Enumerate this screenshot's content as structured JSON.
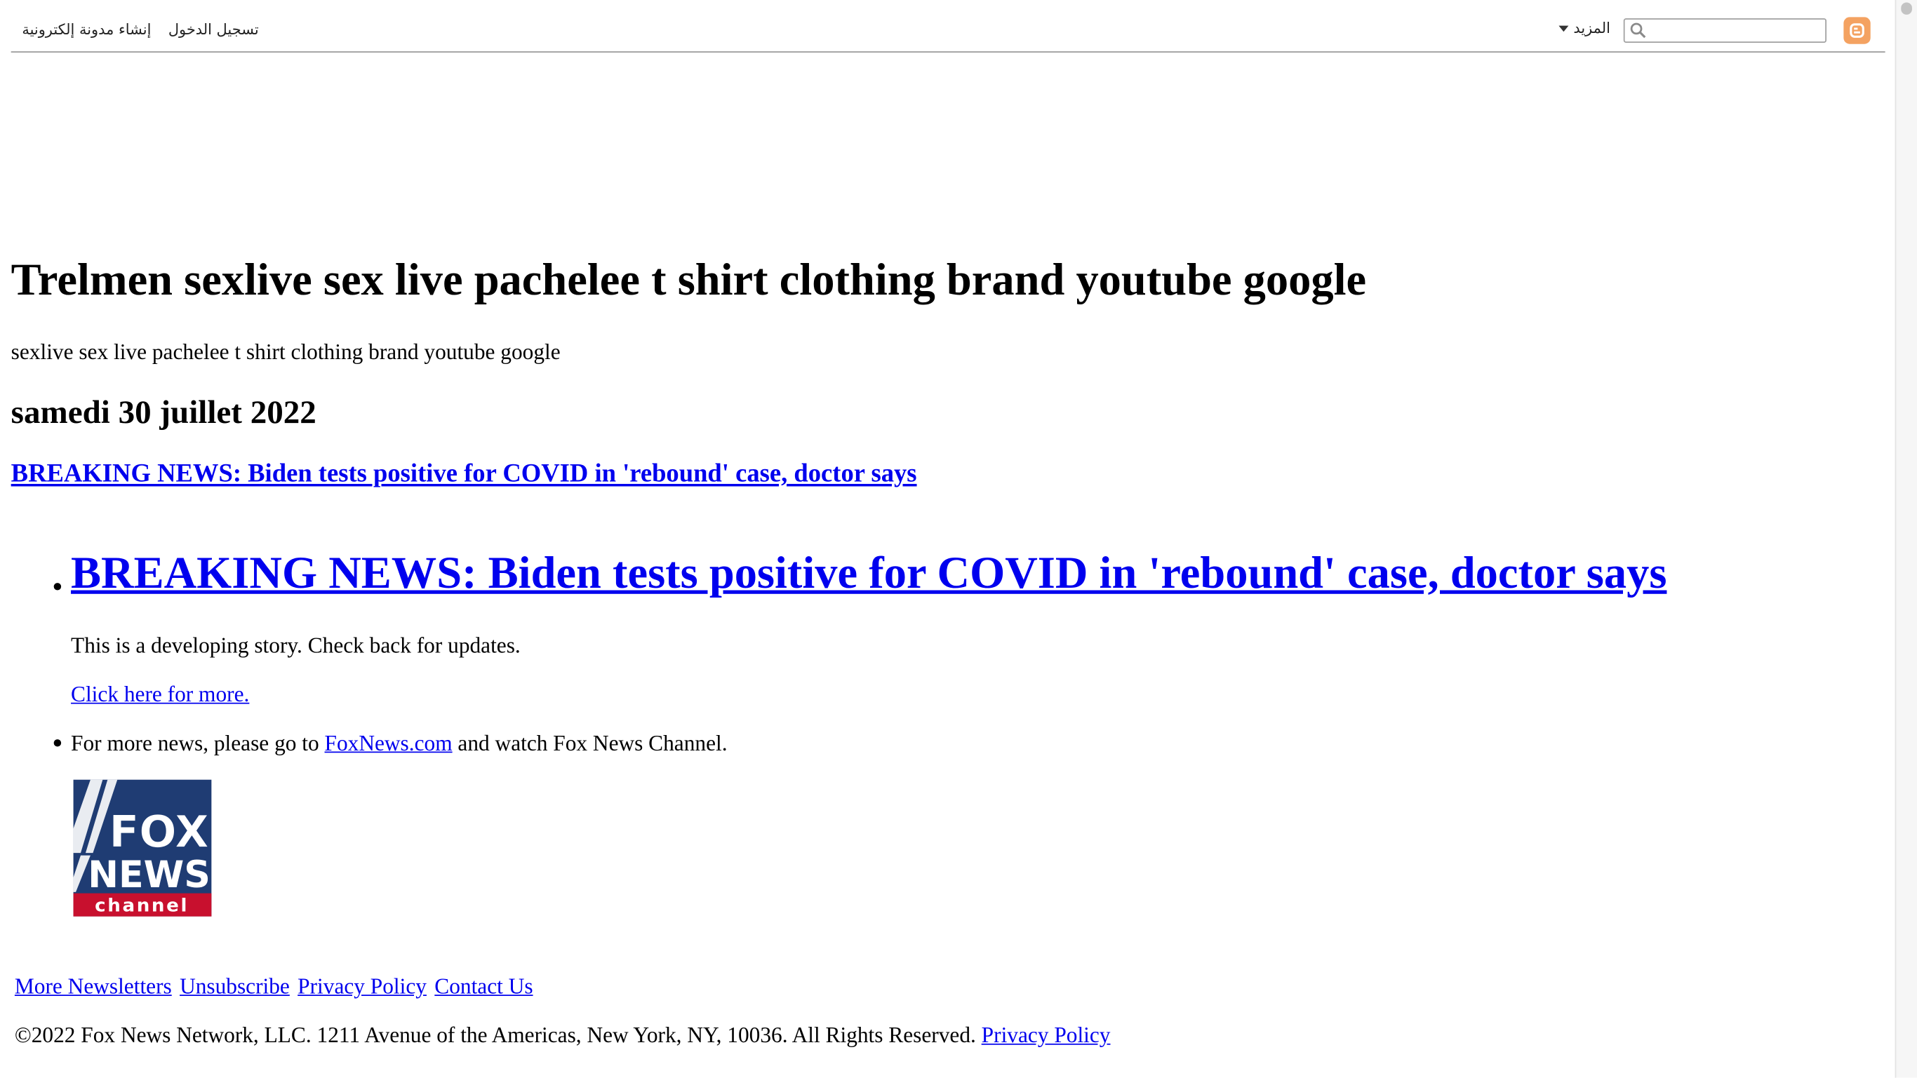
{
  "navbar": {
    "links": [
      "تسجيل الدخول",
      "إنشاء مدونة إلكترونية"
    ],
    "more_label": "المزيد",
    "search_placeholder": ""
  },
  "blog": {
    "title": "Trelmen sexlive sex live pachelee t shirt clothing brand youtube google",
    "description": "sexlive sex live pachelee t shirt clothing brand youtube google"
  },
  "post": {
    "date": "samedi 30 juillet 2022",
    "title": "BREAKING NEWS: Biden tests positive for COVID in 'rebound' case, doctor says",
    "headline": "BREAKING NEWS: Biden tests positive for COVID in 'rebound' case, doctor says",
    "developing_text": "This is a developing story. Check back for updates.",
    "click_more": "Click here for more.",
    "more_news_prefix": "For more news, please go to ",
    "more_news_link": "FoxNews.com",
    "more_news_suffix": " and watch Fox News Channel."
  },
  "logo": {
    "line1": "FOX",
    "line2": "NEWS",
    "line3": "channel",
    "colors": {
      "navy": "#1f3c73",
      "red": "#c8102e"
    }
  },
  "footer": {
    "links": [
      "More Newsletters",
      "Unsubscribe",
      "Privacy Policy",
      "Contact Us"
    ],
    "copyright": "©2022 Fox News Network, LLC. 1211 Avenue of the Americas, New York, NY, 10036. All Rights Reserved. ",
    "copyright_link": "Privacy Policy"
  }
}
